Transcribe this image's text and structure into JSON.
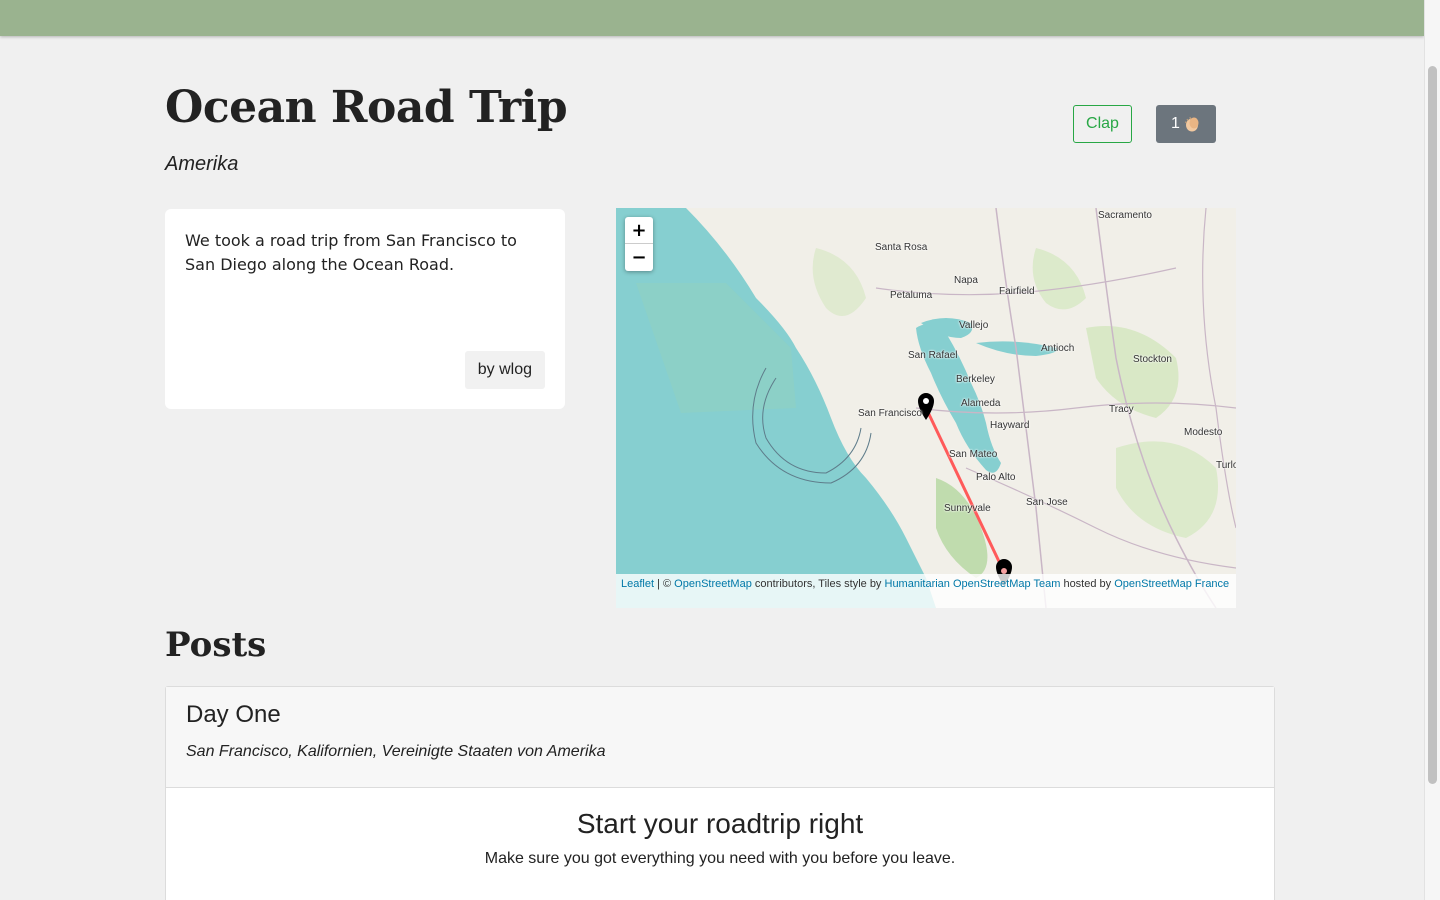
{
  "header": {
    "bar_color": "#9ab38f"
  },
  "trip": {
    "title": "Ocean Road Trip",
    "country": "Amerika",
    "description": "We took a road trip from San Francisco to San Diego along the Ocean Road.",
    "author": "by wlog"
  },
  "actions": {
    "clap_label": "Clap",
    "clap_count": "1",
    "clap_icon": "clapping-hands-icon"
  },
  "map": {
    "zoom_in": "+",
    "zoom_out": "−",
    "route_color": "#ff5a5a",
    "places": [
      "Sacramento",
      "Santa Rosa",
      "Napa",
      "Fairfield",
      "Petaluma",
      "Vallejo",
      "San Rafael",
      "Antioch",
      "Stockton",
      "Berkeley",
      "Alameda",
      "San Francisco",
      "Tracy",
      "Hayward",
      "Modesto",
      "San Mateo",
      "Turlo",
      "Palo Alto",
      "San Jose",
      "Sunnyvale"
    ],
    "attribution": {
      "leaflet": "Leaflet",
      "sep": " | © ",
      "osm": "OpenStreetMap",
      "contrib": " contributors, Tiles style by ",
      "hot": "Humanitarian OpenStreetMap Team",
      "hosted": " hosted by ",
      "osmfr": "OpenStreetMap France"
    }
  },
  "posts": {
    "heading": "Posts",
    "items": [
      {
        "title": "Day One",
        "location": "San Francisco, Kalifornien, Vereinigte Staaten von Amerika",
        "body_title": "Start your roadtrip right",
        "body_text": "Make sure you got everything you need with you before you leave."
      }
    ]
  }
}
